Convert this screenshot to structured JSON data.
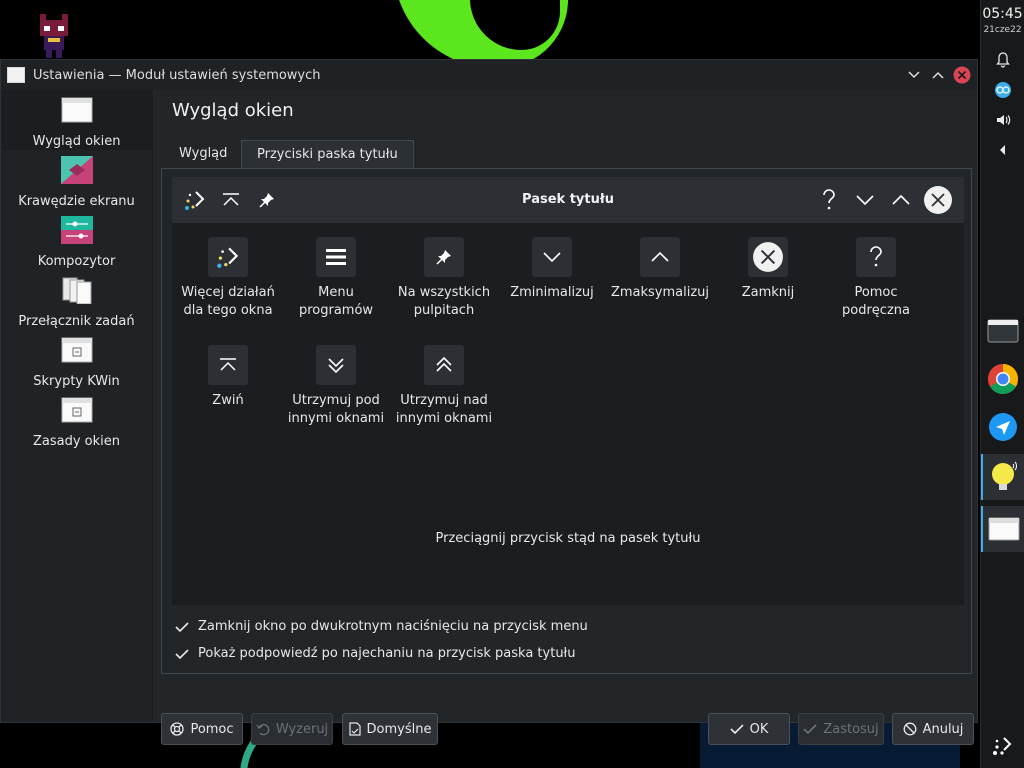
{
  "clock": {
    "time": "05:45",
    "date": "21cze22"
  },
  "window": {
    "title": "Ustawienia — Moduł ustawień systemowych",
    "page_title": "Wygląd okien"
  },
  "sidebar": {
    "items": [
      {
        "label": "Wygląd okien",
        "icon": "window-decoration-icon"
      },
      {
        "label": "Krawędzie ekranu",
        "icon": "screen-edges-icon"
      },
      {
        "label": "Kompozytor",
        "icon": "compositor-icon"
      },
      {
        "label": "Przełącznik zadań",
        "icon": "task-switcher-icon"
      },
      {
        "label": "Skrypty KWin",
        "icon": "kwin-scripts-icon"
      },
      {
        "label": "Zasady okien",
        "icon": "window-rules-icon"
      }
    ]
  },
  "tabs": [
    {
      "label": "Wygląd"
    },
    {
      "label": "Przyciski paska tytułu"
    }
  ],
  "preview": {
    "title": "Pasek tytułu"
  },
  "buttons": [
    {
      "label": "Więcej działań dla tego okna",
      "icon": "more-actions-icon"
    },
    {
      "label": "Menu programów",
      "icon": "menu-icon"
    },
    {
      "label": "Na wszystkich pulpitach",
      "icon": "pin-icon"
    },
    {
      "label": "Zminimalizuj",
      "icon": "minimize-icon"
    },
    {
      "label": "Zmaksymalizuj",
      "icon": "maximize-icon"
    },
    {
      "label": "Zamknij",
      "icon": "close-icon"
    },
    {
      "label": "Pomoc podręczna",
      "icon": "help-icon"
    },
    {
      "label": "Zwiń",
      "icon": "shade-icon"
    },
    {
      "label": "Utrzymuj pod innymi oknami",
      "icon": "keep-below-icon"
    },
    {
      "label": "Utrzymuj nad innymi oknami",
      "icon": "keep-above-icon"
    }
  ],
  "drag_hint": "Przeciągnij przycisk stąd na pasek tytułu",
  "options": [
    {
      "label": "Zamknij okno po dwukrotnym naciśnięciu na przycisk menu",
      "checked": true
    },
    {
      "label": "Pokaż podpowiedź po najechaniu na przycisk paska tytułu",
      "checked": true
    }
  ],
  "footer": {
    "help": "Pomoc",
    "reset": "Wyzeruj",
    "defaults": "Domyślne",
    "ok": "OK",
    "apply": "Zastosuj",
    "cancel": "Anuluj"
  },
  "colors": {
    "accent": "#3daee9",
    "close_red": "#da4453",
    "bg": "#232629"
  }
}
